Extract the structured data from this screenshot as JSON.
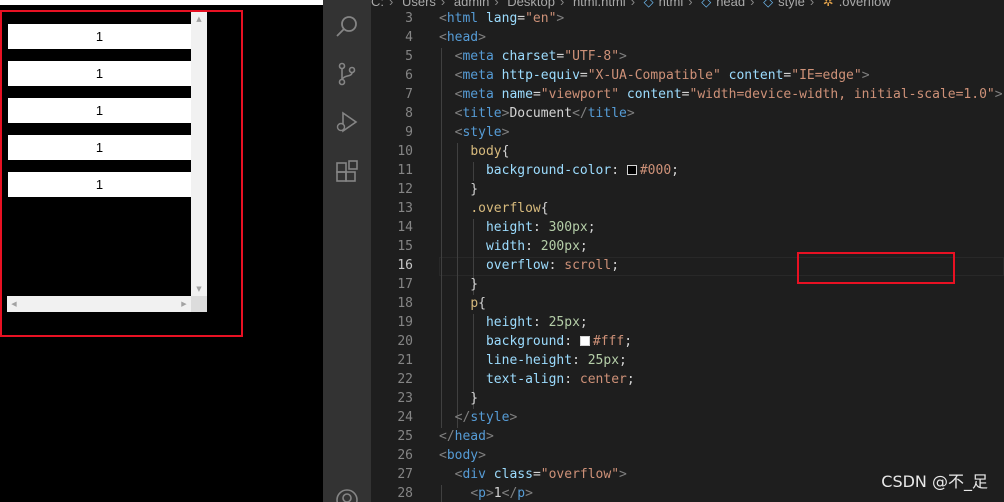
{
  "preview": {
    "rows": [
      "1",
      "1",
      "1",
      "1",
      "1"
    ]
  },
  "breadcrumb": [
    "C:",
    "Users",
    "admin",
    "Desktop",
    "html.html",
    "html",
    "head",
    "style",
    ".overflow"
  ],
  "editor": {
    "current_line": "16",
    "lines": [
      {
        "n": "3",
        "html": "<span class=\"t-br\">&lt;</span><span class=\"t-tag\">html</span> <span class=\"t-attr\">lang</span>=<span class=\"t-str\">\"en\"</span><span class=\"t-br\">&gt;</span>"
      },
      {
        "n": "4",
        "html": "<span class=\"t-br\">&lt;</span><span class=\"t-tag\">head</span><span class=\"t-br\">&gt;</span>"
      },
      {
        "n": "5",
        "html": "  <span class=\"t-br\">&lt;</span><span class=\"t-tag\">meta</span> <span class=\"t-attr\">charset</span>=<span class=\"t-str\">\"UTF-8\"</span><span class=\"t-br\">&gt;</span>"
      },
      {
        "n": "6",
        "html": "  <span class=\"t-br\">&lt;</span><span class=\"t-tag\">meta</span> <span class=\"t-attr\">http-equiv</span>=<span class=\"t-str\">\"X-UA-Compatible\"</span> <span class=\"t-attr\">content</span>=<span class=\"t-str\">\"IE=edge\"</span><span class=\"t-br\">&gt;</span>"
      },
      {
        "n": "7",
        "html": "  <span class=\"t-br\">&lt;</span><span class=\"t-tag\">meta</span> <span class=\"t-attr\">name</span>=<span class=\"t-str\">\"viewport\"</span> <span class=\"t-attr\">content</span>=<span class=\"t-str\">\"width=device-width, initial-scale=1.0\"</span><span class=\"t-br\">&gt;</span>"
      },
      {
        "n": "8",
        "html": "  <span class=\"t-br\">&lt;</span><span class=\"t-tag\">title</span><span class=\"t-br\">&gt;</span><span class=\"t-txt\">Document</span><span class=\"t-br\">&lt;/</span><span class=\"t-tag\">title</span><span class=\"t-br\">&gt;</span>"
      },
      {
        "n": "9",
        "html": "  <span class=\"t-br\">&lt;</span><span class=\"t-tag\">style</span><span class=\"t-br\">&gt;</span>"
      },
      {
        "n": "10",
        "html": "    <span class=\"t-sel\">body</span>{"
      },
      {
        "n": "11",
        "html": "      <span class=\"t-prop\">background-color</span>: <span class=\"swatch\" style=\"background:#000\"></span><span class=\"t-str\">#000</span>;"
      },
      {
        "n": "12",
        "html": "    }"
      },
      {
        "n": "13",
        "html": "    <span class=\"t-sel\">.overflow</span>{"
      },
      {
        "n": "14",
        "html": "      <span class=\"t-prop\">height</span>: <span class=\"t-num\">300px</span>;"
      },
      {
        "n": "15",
        "html": "      <span class=\"t-prop\">width</span>: <span class=\"t-num\">200px</span>;"
      },
      {
        "n": "16",
        "html": "      <span class=\"t-prop\">overflow</span>: <span class=\"t-str\">scroll</span>;"
      },
      {
        "n": "17",
        "html": "    }"
      },
      {
        "n": "18",
        "html": "    <span class=\"t-sel\">p</span>{"
      },
      {
        "n": "19",
        "html": "      <span class=\"t-prop\">height</span>: <span class=\"t-num\">25px</span>;"
      },
      {
        "n": "20",
        "html": "      <span class=\"t-prop\">background</span>: <span class=\"swatch\" style=\"background:#fff\"></span><span class=\"t-str\">#fff</span>;"
      },
      {
        "n": "21",
        "html": "      <span class=\"t-prop\">line-height</span>: <span class=\"t-num\">25px</span>;"
      },
      {
        "n": "22",
        "html": "      <span class=\"t-prop\">text-align</span>: <span class=\"t-str\">center</span>;"
      },
      {
        "n": "23",
        "html": "    }"
      },
      {
        "n": "24",
        "html": "  <span class=\"t-br\">&lt;/</span><span class=\"t-tag\">style</span><span class=\"t-br\">&gt;</span>"
      },
      {
        "n": "25",
        "html": "<span class=\"t-br\">&lt;/</span><span class=\"t-tag\">head</span><span class=\"t-br\">&gt;</span>"
      },
      {
        "n": "26",
        "html": "<span class=\"t-br\">&lt;</span><span class=\"t-tag\">body</span><span class=\"t-br\">&gt;</span>"
      },
      {
        "n": "27",
        "html": "  <span class=\"t-br\">&lt;</span><span class=\"t-tag\">div</span> <span class=\"t-attr\">class</span>=<span class=\"t-str\">\"overflow\"</span><span class=\"t-br\">&gt;</span>"
      },
      {
        "n": "28",
        "html": "    <span class=\"t-br\">&lt;</span><span class=\"t-tag\">p</span><span class=\"t-br\">&gt;</span><span class=\"t-txt\">1</span><span class=\"t-br\">&lt;/</span><span class=\"t-tag\">p</span><span class=\"t-br\">&gt;</span>"
      }
    ]
  },
  "watermark": "CSDN @不_足"
}
